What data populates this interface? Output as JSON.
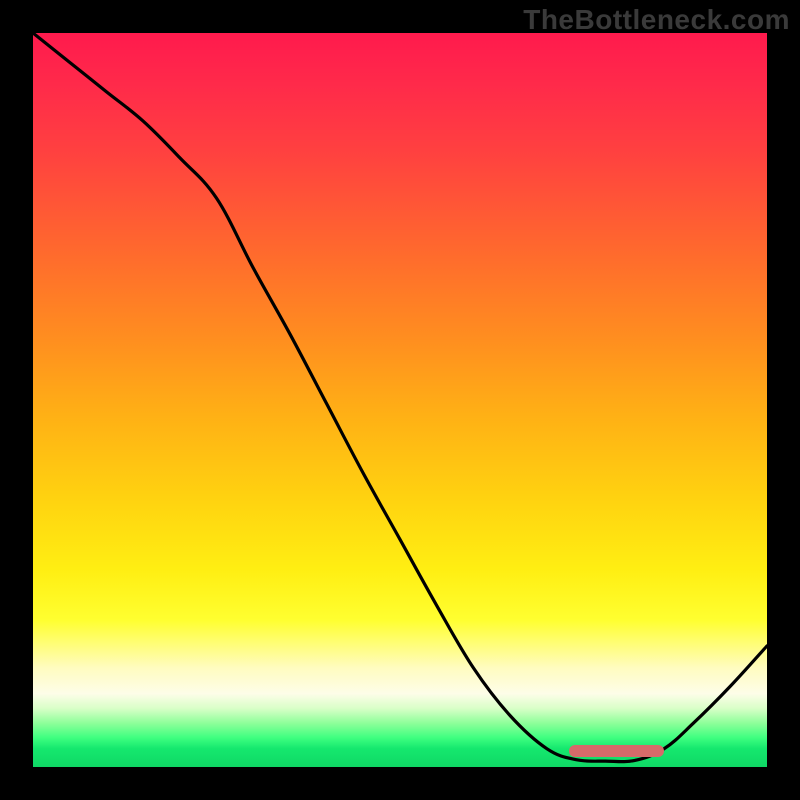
{
  "watermark": "TheBottleneck.com",
  "chart_data": {
    "type": "line",
    "title": "",
    "xlabel": "",
    "ylabel": "",
    "xlim": [
      0,
      100
    ],
    "ylim": [
      0,
      100
    ],
    "x": [
      0,
      5,
      10,
      15,
      20,
      25,
      30,
      35,
      40,
      45,
      50,
      55,
      60,
      65,
      70,
      74,
      78,
      82,
      86,
      90,
      95,
      100
    ],
    "values": [
      100,
      96,
      92,
      88,
      83,
      77.5,
      68,
      59,
      49.5,
      40,
      31,
      22,
      13.5,
      7,
      2.5,
      1,
      0.8,
      0.9,
      2.5,
      6,
      11,
      16.5
    ],
    "optimal_range_x": [
      73,
      86
    ],
    "gradient_stops": [
      {
        "pos": 0,
        "color": "#ff1a4d"
      },
      {
        "pos": 0.3,
        "color": "#ff6a2d"
      },
      {
        "pos": 0.63,
        "color": "#ffd110"
      },
      {
        "pos": 0.8,
        "color": "#ffff30"
      },
      {
        "pos": 0.9,
        "color": "#fdfde8"
      },
      {
        "pos": 1.0,
        "color": "#0fd865"
      }
    ]
  }
}
